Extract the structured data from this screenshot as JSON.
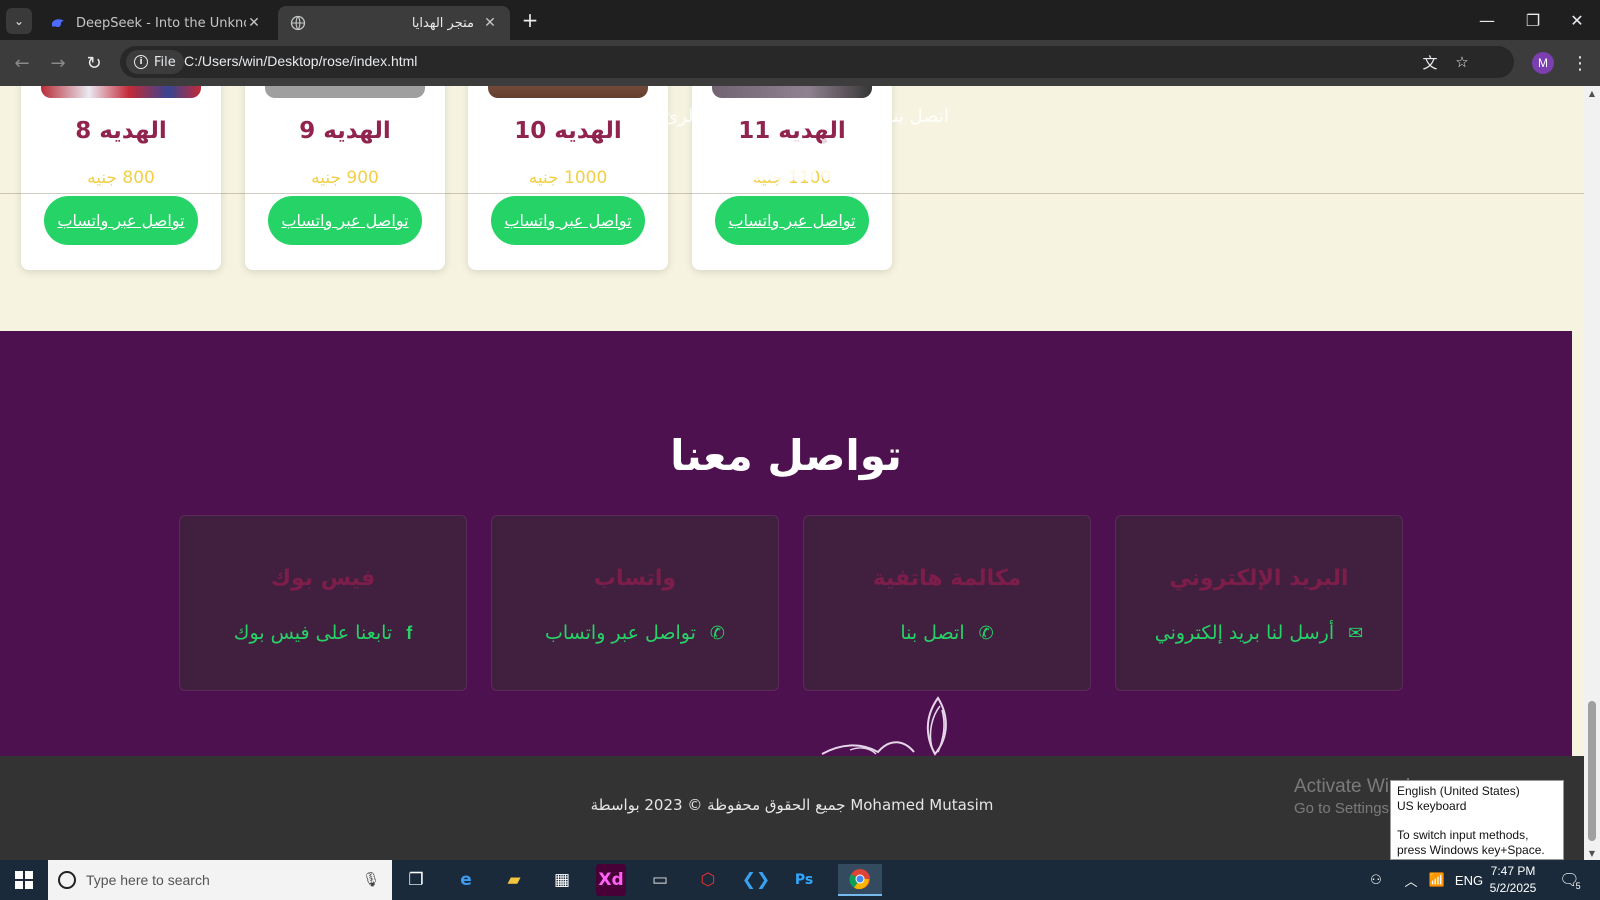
{
  "browser": {
    "tabs": [
      {
        "title": "DeepSeek - Into the Unknown",
        "active": false
      },
      {
        "title": "متجر الهدايا",
        "active": true
      }
    ],
    "address_chip": "File",
    "url": "C:/Users/win/Desktop/rose/index.html",
    "profile_initial": "M"
  },
  "ghost_header": {
    "nav_text_1": "اتصل بنا",
    "nav_text_2": "الرئ"
  },
  "products": [
    {
      "name": "الهديه 8",
      "price": "800 جنيه",
      "button": "تواصل عبر واتساب"
    },
    {
      "name": "الهديه 9",
      "price": "900 جنيه",
      "button": "تواصل عبر واتساب"
    },
    {
      "name": "الهديه 10",
      "price": "1000 جنيه",
      "button": "تواصل عبر واتساب"
    },
    {
      "name": "الهديه 11",
      "price": "1100 جنيه",
      "button": "تواصل عبر واتساب"
    }
  ],
  "contact": {
    "title": "تواصل معنا",
    "cards": [
      {
        "title": "البريد الإلكتروني",
        "link": "أرسل لنا بريد إلكتروني",
        "icon": "envelope-icon",
        "glyph": "✉"
      },
      {
        "title": "مكالمة هاتفية",
        "link": "اتصل بنا",
        "icon": "phone-icon",
        "glyph": "✆"
      },
      {
        "title": "واتساب",
        "link": "تواصل عبر واتساب",
        "icon": "whatsapp-icon",
        "glyph": "✆"
      },
      {
        "title": "فيس بوك",
        "link": "تابعنا على فيس بوك",
        "icon": "facebook-icon",
        "glyph": "f"
      }
    ]
  },
  "footer": {
    "copyright": "جميع الحقوق محفوظة © 2023 بواسطة Mohamed Mutasim"
  },
  "watermark": {
    "line1": "Activate Windows",
    "line2": "Go to Settings to activate Windows."
  },
  "ime_tooltip": {
    "line1": "English (United States)",
    "line2": "US keyboard",
    "line3": "To switch input methods, press Windows key+Space."
  },
  "taskbar": {
    "search_placeholder": "Type here to search",
    "language": "ENG",
    "time": "7:47 PM",
    "date": "5/2/2025",
    "notification_count": "5"
  },
  "colors": {
    "page_bg": "#f6f4e0",
    "contact_bg": "#4e1150",
    "accent_green": "#25d366",
    "product_name": "#8a1745",
    "price_gold": "#f2cd3d",
    "footer_bg": "#333333"
  }
}
